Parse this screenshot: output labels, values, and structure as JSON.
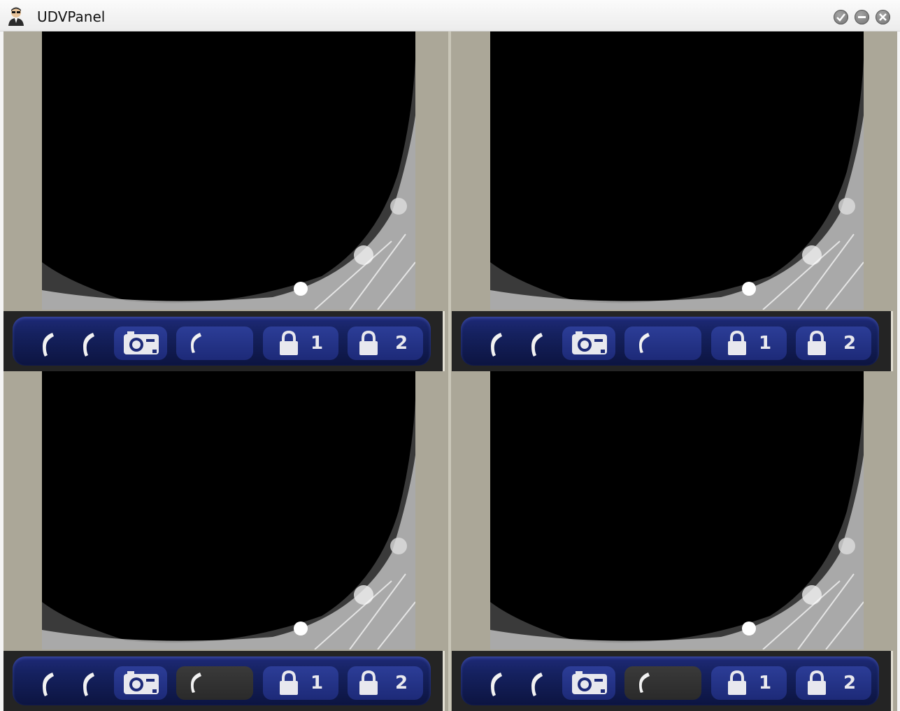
{
  "window": {
    "title": "UDVPanel",
    "icon": "agent-avatar-icon",
    "controls": [
      "ok-icon",
      "minimize-icon",
      "close-icon"
    ]
  },
  "panels": [
    {
      "id": "tl",
      "lock1_label": "1",
      "lock2_label": "2",
      "call_active": true
    },
    {
      "id": "tr",
      "lock1_label": "1",
      "lock2_label": "2",
      "call_active": true
    },
    {
      "id": "bl",
      "lock1_label": "1",
      "lock2_label": "2",
      "call_active": false
    },
    {
      "id": "br",
      "lock1_label": "1",
      "lock2_label": "2",
      "call_active": false
    }
  ],
  "colors": {
    "panel_bg": "#aba798",
    "toolbar_blue": "#1d2a78",
    "toolbar_gray": "#2a2a2a",
    "video_bg": "#000000"
  }
}
